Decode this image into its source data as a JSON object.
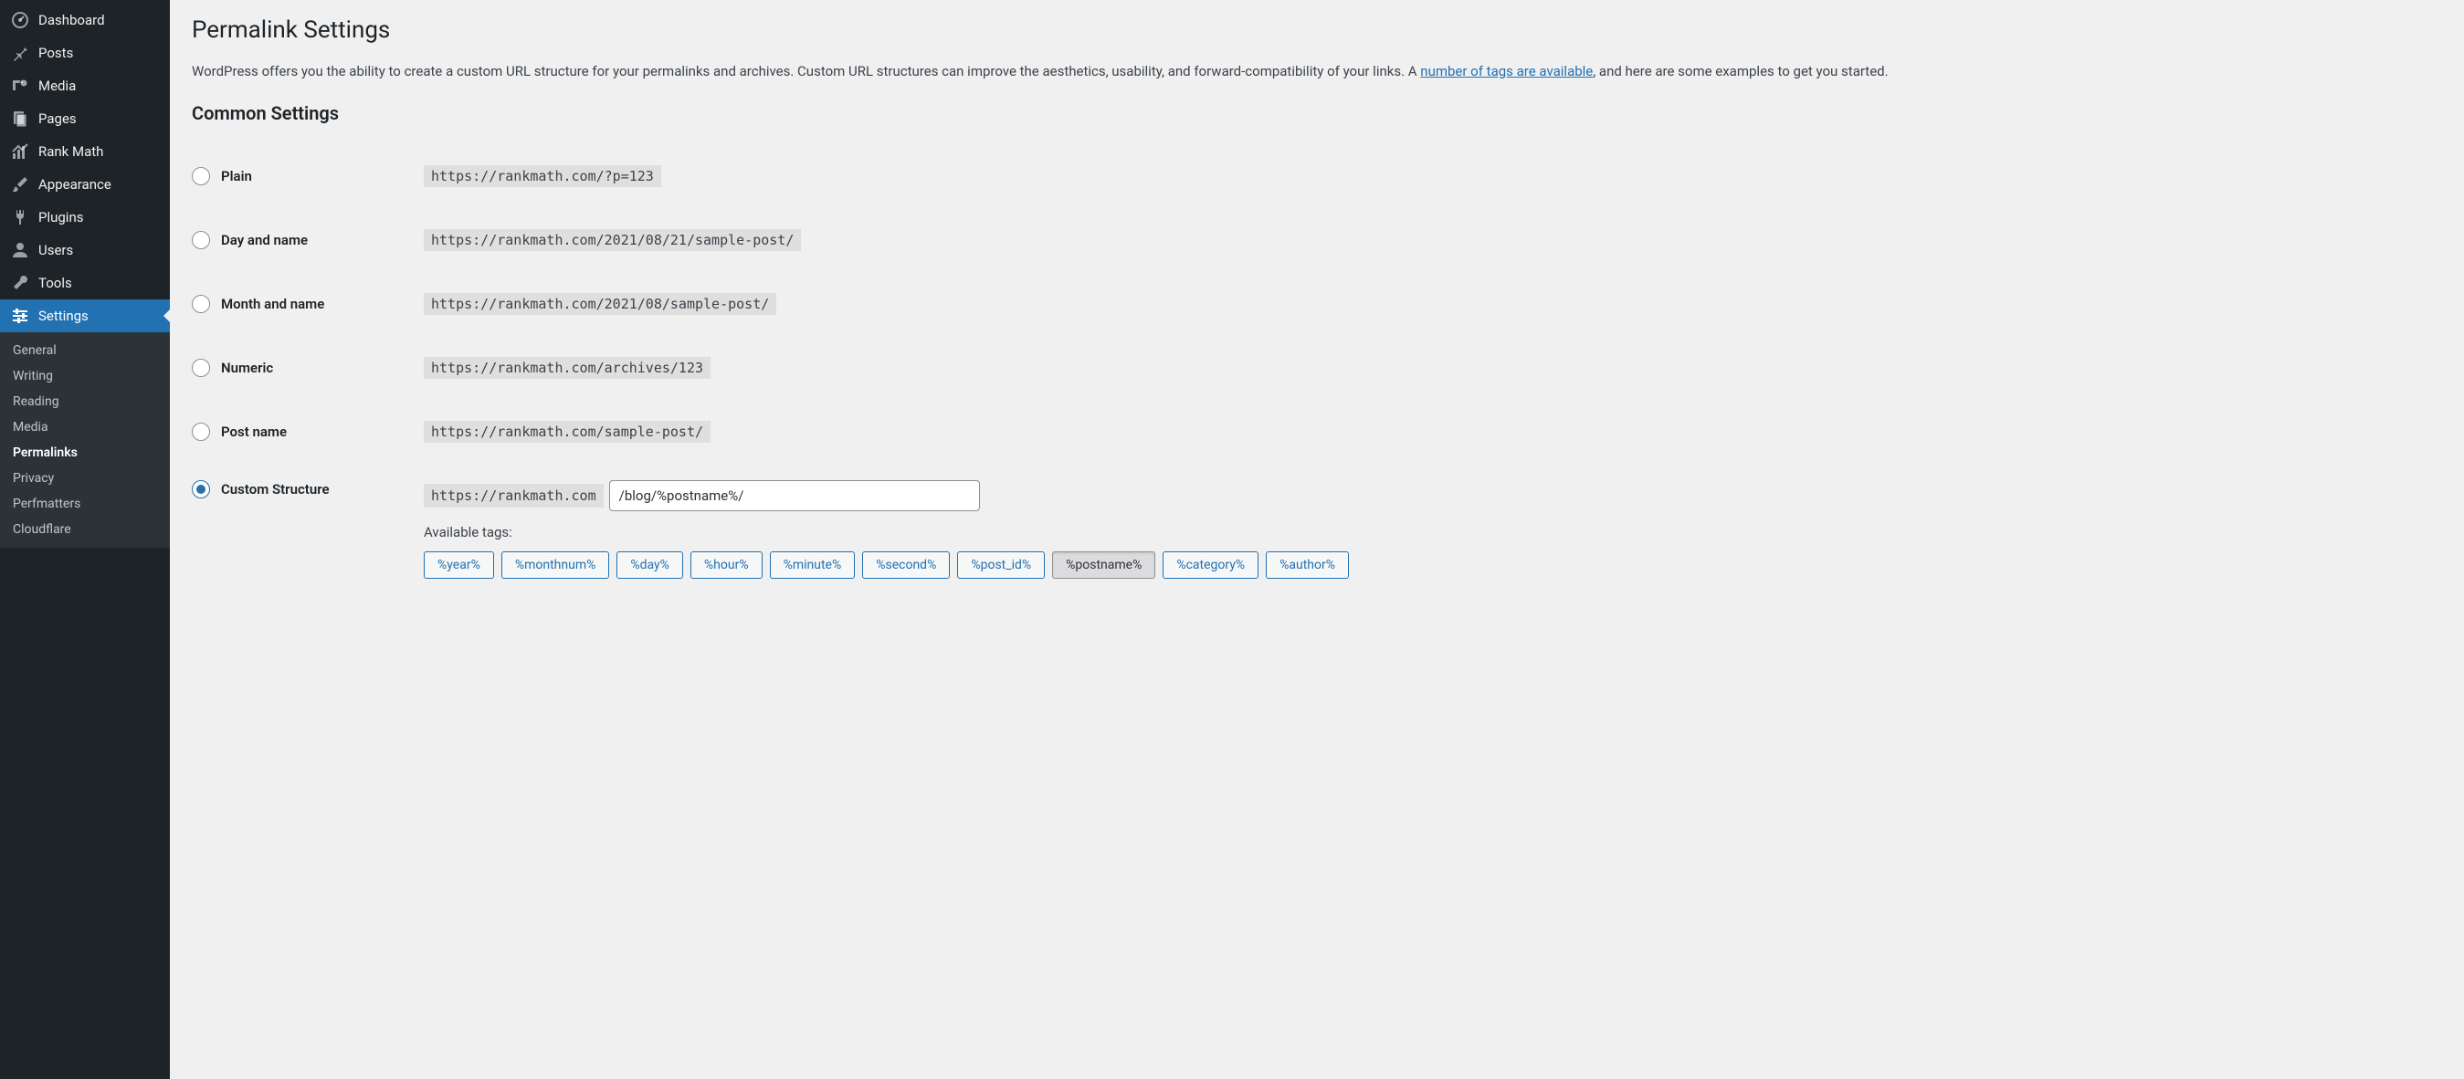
{
  "sidebar": {
    "items": [
      {
        "label": "Dashboard"
      },
      {
        "label": "Posts"
      },
      {
        "label": "Media"
      },
      {
        "label": "Pages"
      },
      {
        "label": "Rank Math"
      },
      {
        "label": "Appearance"
      },
      {
        "label": "Plugins"
      },
      {
        "label": "Users"
      },
      {
        "label": "Tools"
      },
      {
        "label": "Settings"
      }
    ],
    "sub": [
      {
        "label": "General"
      },
      {
        "label": "Writing"
      },
      {
        "label": "Reading"
      },
      {
        "label": "Media"
      },
      {
        "label": "Permalinks"
      },
      {
        "label": "Privacy"
      },
      {
        "label": "Perfmatters"
      },
      {
        "label": "Cloudflare"
      }
    ]
  },
  "page": {
    "title": "Permalink Settings",
    "intro_1": "WordPress offers you the ability to create a custom URL structure for your permalinks and archives. Custom URL structures can improve the aesthetics, usability, and forward-compatibility of your links. A ",
    "intro_link": "number of tags are available",
    "intro_2": ", and here are some examples to get you started.",
    "common_heading": "Common Settings"
  },
  "options": {
    "plain": {
      "label": "Plain",
      "example": "https://rankmath.com/?p=123"
    },
    "dayname": {
      "label": "Day and name",
      "example": "https://rankmath.com/2021/08/21/sample-post/"
    },
    "monthname": {
      "label": "Month and name",
      "example": "https://rankmath.com/2021/08/sample-post/"
    },
    "numeric": {
      "label": "Numeric",
      "example": "https://rankmath.com/archives/123"
    },
    "postname": {
      "label": "Post name",
      "example": "https://rankmath.com/sample-post/"
    },
    "custom": {
      "label": "Custom Structure",
      "prefix": "https://rankmath.com",
      "value": "/blog/%postname%/"
    }
  },
  "available_tags_label": "Available tags:",
  "tags": [
    "%year%",
    "%monthnum%",
    "%day%",
    "%hour%",
    "%minute%",
    "%second%",
    "%post_id%",
    "%postname%",
    "%category%",
    "%author%"
  ]
}
